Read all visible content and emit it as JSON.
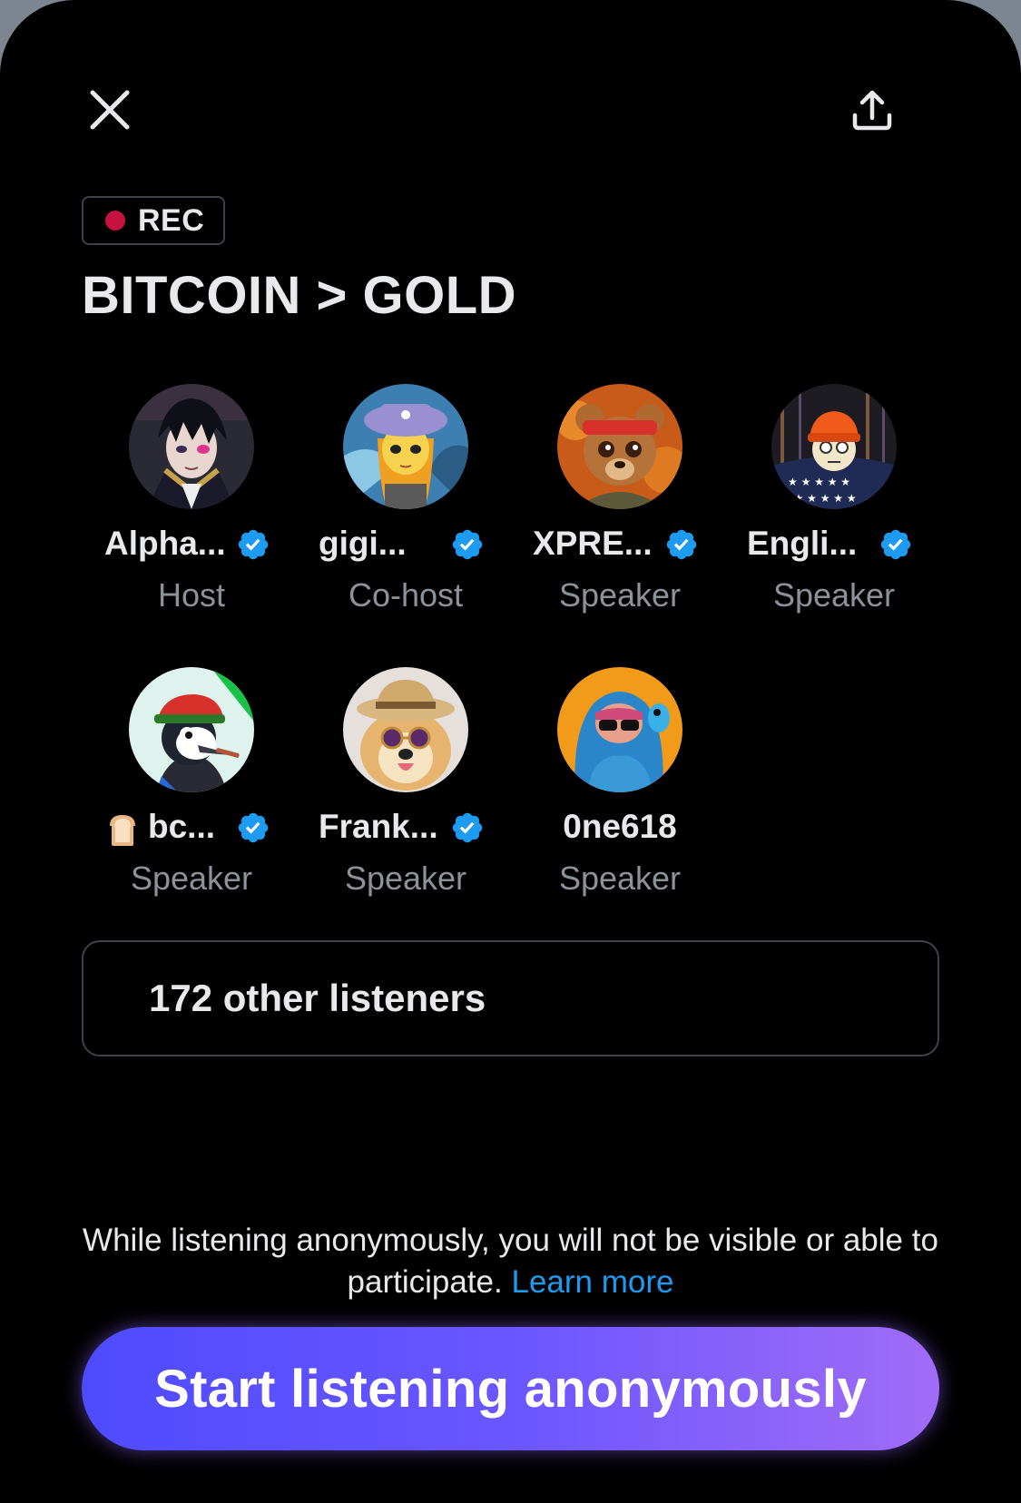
{
  "rec": {
    "label": "REC",
    "dot_color": "#c5123f"
  },
  "space": {
    "title": "BITCOIN > GOLD"
  },
  "participants": [
    {
      "name": "Alpha...",
      "role": "Host",
      "verified": true,
      "avatar": "anime-character-avatar"
    },
    {
      "name": "gigi...",
      "role": "Co-host",
      "verified": true,
      "avatar": "cartoon-girl-hat-avatar"
    },
    {
      "name": "XPRE...",
      "role": "Speaker",
      "verified": true,
      "avatar": "bear-headband-avatar"
    },
    {
      "name": "Engli...",
      "role": "Speaker",
      "verified": true,
      "avatar": "orange-beanie-avatar"
    },
    {
      "name": "bc...",
      "role": "Speaker",
      "verified": true,
      "avatar": "bird-cap-cigar-avatar",
      "emoji": "🍞"
    },
    {
      "name": "Frank...",
      "role": "Speaker",
      "verified": true,
      "avatar": "dog-hat-sunglasses-avatar"
    },
    {
      "name": "0ne618",
      "role": "Speaker",
      "verified": false,
      "avatar": "blue-hood-sunglasses-avatar"
    }
  ],
  "listeners": {
    "label": "172 other listeners"
  },
  "notice": {
    "text": "While listening anonymously, you will not be visible or able to participate.",
    "link": "Learn more"
  },
  "cta": {
    "label": "Start listening anonymously"
  },
  "colors": {
    "background": "#000000",
    "verified_badge": "#1d9bf0",
    "link": "#1d9bf0",
    "cta_gradient_start": "#4e4bff",
    "cta_gradient_end": "#a16cf7",
    "muted_text": "#8b9299"
  },
  "icons": {
    "close": "close-icon",
    "share": "share-icon",
    "verified": "verified-badge-icon"
  }
}
